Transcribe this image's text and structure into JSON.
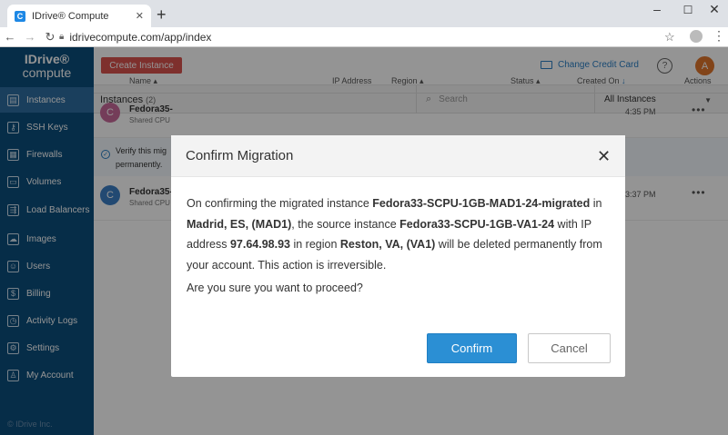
{
  "browser": {
    "tab_title": "IDrive® Compute",
    "tab_icon": "C",
    "url": "idrivecompute.com/app/index"
  },
  "sidebar": {
    "logo_top": "IDrive®",
    "logo_bottom": "compute",
    "items": [
      {
        "label": "Instances",
        "icon": "instances-icon"
      },
      {
        "label": "SSH Keys",
        "icon": "key-icon"
      },
      {
        "label": "Firewalls",
        "icon": "firewall-icon"
      },
      {
        "label": "Volumes",
        "icon": "volume-icon"
      },
      {
        "label": "Load Balancers",
        "icon": "load-balancer-icon"
      },
      {
        "label": "Images",
        "icon": "cloud-icon"
      },
      {
        "label": "Users",
        "icon": "user-icon"
      },
      {
        "label": "Billing",
        "icon": "billing-icon"
      },
      {
        "label": "Activity Logs",
        "icon": "history-icon"
      },
      {
        "label": "Settings",
        "icon": "gear-icon"
      },
      {
        "label": "My Account",
        "icon": "account-icon"
      }
    ],
    "footer": "© IDrive Inc."
  },
  "topbar": {
    "create_label": "Create Instance",
    "credit_label": "Change Credit Card",
    "help": "?",
    "avatar_letter": "A"
  },
  "filter": {
    "title": "Instances",
    "count": "(2)",
    "search_placeholder": "Search",
    "select_value": "All Instances"
  },
  "table": {
    "headers": [
      "Name",
      "IP Address",
      "Region",
      "Status",
      "Created On",
      "Actions"
    ],
    "rows": [
      {
        "avatar": "C",
        "name": "Fedora35-",
        "sub": "Shared CPU",
        "time": "4:35 PM"
      },
      {
        "avatar": "C",
        "name": "Fedora35-",
        "sub": "Shared CPU",
        "time": "3:37 PM"
      }
    ],
    "verify_line1": "Verify this mig",
    "verify_line2": "permanently."
  },
  "modal": {
    "title": "Confirm Migration",
    "close": "✕",
    "p1": "On confirming the migrated instance ",
    "migrated_instance": "Fedora33-SCPU-1GB-MAD1-24-migrated",
    "p2": " in ",
    "new_region": "Madrid, ES, (MAD1)",
    "p3": ", the source instance ",
    "source_instance": "Fedora33-SCPU-1GB-VA1-24",
    "p4": " with IP address ",
    "ip": "97.64.98.93",
    "p5": " in region ",
    "old_region": "Reston, VA, (VA1)",
    "p6": " will be deleted permanently from your account. This action is irreversible.",
    "question": "Are you sure you want to proceed?",
    "confirm_label": "Confirm",
    "cancel_label": "Cancel"
  },
  "colors": {
    "sidebar": "#0c4e7d",
    "sidebar_active": "#2d6da0",
    "create_button": "#d9534f",
    "confirm_button": "#2b8fd4",
    "avatar": "#e0752b",
    "row1_avatar": "#c9699a",
    "row2_avatar": "#3c7fc4"
  }
}
